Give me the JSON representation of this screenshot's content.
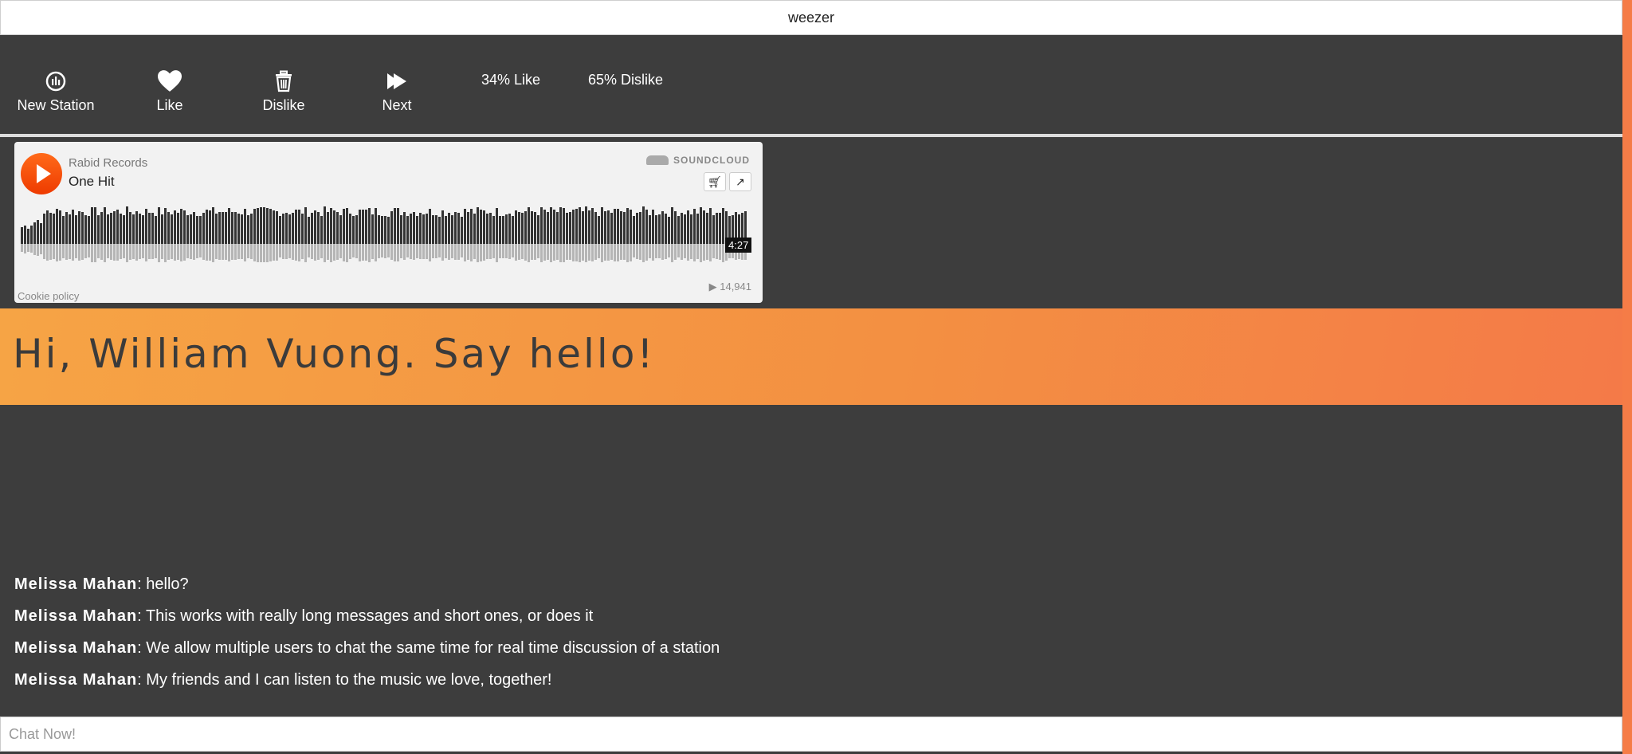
{
  "window": {
    "title": "weezer"
  },
  "toolbar": {
    "new_station_label": "New Station",
    "like_label": "Like",
    "dislike_label": "Dislike",
    "next_label": "Next",
    "like_percent": "34% Like",
    "dislike_percent": "65% Dislike"
  },
  "player": {
    "artist": "Rabid Records",
    "track": "One Hit",
    "brand": "SOUNDCLOUD",
    "duration": "4:27",
    "plays": "14,941",
    "cookie_policy": "Cookie policy",
    "buy_icon": "cart-icon",
    "share_icon": "share-icon",
    "accent_color": "#ff5500"
  },
  "banner": {
    "greeting": "Hi, William Vuong. Say hello!"
  },
  "chat": {
    "messages": [
      {
        "user": "Melissa Mahan",
        "text": "hello?"
      },
      {
        "user": "Melissa Mahan",
        "text": "This works with really long messages and short ones, or does it"
      },
      {
        "user": "Melissa Mahan",
        "text": "We allow multiple users to chat the same time for real time discussion of a station"
      },
      {
        "user": "Melissa Mahan",
        "text": "My friends and I can listen to the music we love, together!"
      }
    ],
    "input_placeholder": "Chat Now!"
  }
}
